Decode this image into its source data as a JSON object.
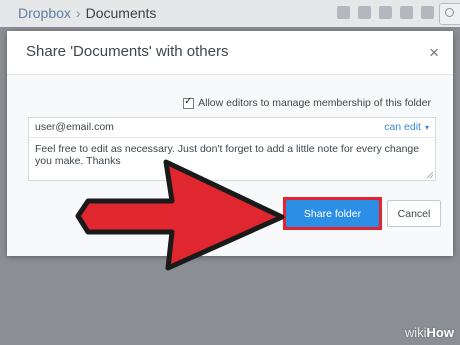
{
  "header": {
    "crumb_root": "Dropbox",
    "crumb_sep": "›",
    "crumb_current": "Documents",
    "toolbar_icons": [
      "upload-icon",
      "new-folder-icon",
      "shared-folder-icon",
      "link-icon",
      "delete-icon"
    ]
  },
  "dialog": {
    "title": "Share 'Documents' with others",
    "close_label": "×",
    "allow_label": "Allow editors to manage membership of this folder",
    "allow_checked": true,
    "email": "user@email.com",
    "permission": "can edit",
    "permission_caret": "▾",
    "note": "Feel free to edit as necessary.  Just don't forget to add a little note for every change you make. Thanks",
    "share_label": "Share folder",
    "cancel_label": "Cancel"
  },
  "colors": {
    "primary": "#2d8ee6",
    "highlight": "#e3262e",
    "link": "#3a87d6"
  },
  "watermark": {
    "wiki": "wiki",
    "how": "How"
  }
}
